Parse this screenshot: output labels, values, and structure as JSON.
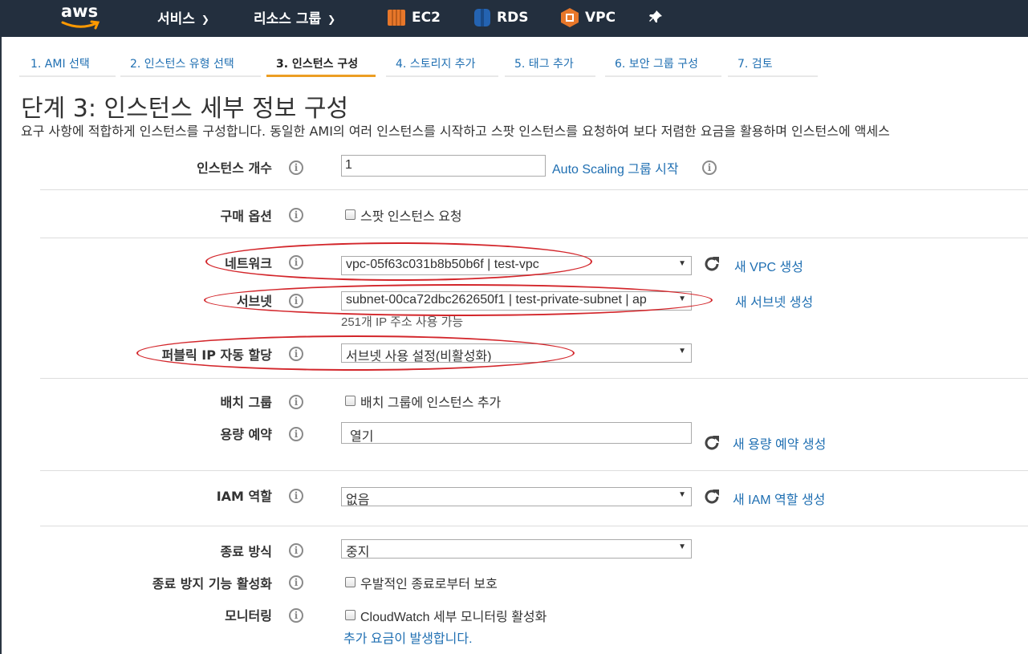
{
  "topnav": {
    "logo": "aws",
    "services": "서비스",
    "resource_groups": "리소스 그룹",
    "ec2": "EC2",
    "rds": "RDS",
    "vpc": "VPC"
  },
  "wizard_tabs": [
    {
      "label": "1. AMI 선택"
    },
    {
      "label": "2. 인스턴스 유형 선택"
    },
    {
      "label": "3. 인스턴스 구성",
      "active": true
    },
    {
      "label": "4. 스토리지 추가"
    },
    {
      "label": "5. 태그 추가"
    },
    {
      "label": "6. 보안 그룹 구성"
    },
    {
      "label": "7. 검토"
    }
  ],
  "page": {
    "title": "단계 3: 인스턴스 세부 정보 구성",
    "description": "요구 사항에 적합하게 인스턴스를 구성합니다. 동일한 AMI의 여러 인스턴스를 시작하고 스팟 인스턴스를 요청하여 보다 저렴한 요금을 활용하며 인스턴스에 액세스"
  },
  "form": {
    "instance_count": {
      "label": "인스턴스 개수",
      "value": "1",
      "link": "Auto Scaling 그룹 시작"
    },
    "purchase_option": {
      "label": "구매 옵션",
      "checkbox": "스팟 인스턴스 요청"
    },
    "network": {
      "label": "네트워크",
      "value": "vpc-05f63c031b8b50b6f | test-vpc",
      "link": "새 VPC 생성"
    },
    "subnet": {
      "label": "서브넷",
      "value": "subnet-00ca72dbc262650f1 | test-private-subnet | ap",
      "link": "새 서브넷 생성",
      "help": "251개 IP 주소 사용 가능"
    },
    "public_ip": {
      "label": "퍼블릭 IP 자동 할당",
      "value": "서브넷 사용 설정(비활성화)"
    },
    "placement_group": {
      "label": "배치 그룹",
      "checkbox": "배치 그룹에 인스턴스 추가"
    },
    "capacity_reservation": {
      "label": "용량 예약",
      "value": "열기",
      "link": "새 용량 예약 생성"
    },
    "iam_role": {
      "label": "IAM 역할",
      "value": "없음",
      "link": "새 IAM 역할 생성"
    },
    "shutdown": {
      "label": "종료 방식",
      "value": "중지"
    },
    "termination_protection": {
      "label": "종료 방지 기능 활성화",
      "checkbox": "우발적인 종료로부터 보호"
    },
    "monitoring": {
      "label": "모니터링",
      "checkbox": "CloudWatch 세부 모니터링 활성화",
      "note": "추가 요금이 발생합니다."
    }
  },
  "colors": {
    "nav_bg": "#232f3e",
    "link": "#1f6fb2",
    "tab_active_underline": "#ec9e23",
    "highlight_ellipse": "#d3262b"
  }
}
